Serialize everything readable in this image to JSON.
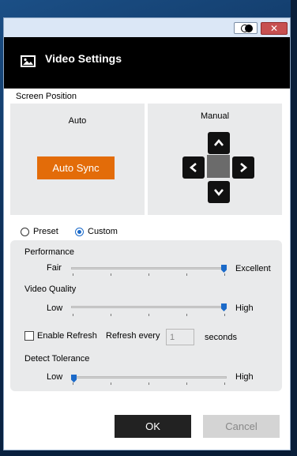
{
  "window": {
    "title": "Video Settings",
    "close_glyph": "✕",
    "icons": {
      "toggle": "contrast-toggle-icon",
      "close": "close-icon",
      "header": "image-icon"
    }
  },
  "screen_position": {
    "label": "Screen Position",
    "auto": {
      "label": "Auto",
      "button": "Auto Sync"
    },
    "manual": {
      "label": "Manual",
      "buttons": [
        "up-arrow-icon",
        "left-arrow-icon",
        "right-arrow-icon",
        "down-arrow-icon"
      ]
    }
  },
  "mode": {
    "options": [
      "Preset",
      "Custom"
    ],
    "selected": "Custom"
  },
  "performance": {
    "label": "Performance",
    "min_label": "Fair",
    "max_label": "Excellent",
    "value_fraction": 1.0
  },
  "video_quality": {
    "label": "Video Quality",
    "min_label": "Low",
    "max_label": "High",
    "value_fraction": 1.0
  },
  "refresh": {
    "enable_label": "Enable Refresh",
    "enabled": false,
    "every_label": "Refresh every",
    "value": "1",
    "unit": "seconds"
  },
  "detect_tolerance": {
    "label": "Detect Tolerance",
    "min_label": "Low",
    "max_label": "High",
    "value_fraction": 0.0
  },
  "footer": {
    "ok": "OK",
    "cancel": "Cancel"
  },
  "colors": {
    "accent": "#1b6ac9",
    "auto_sync": "#e36c09",
    "header_bg": "#000000",
    "panel_bg": "#e9eaeb"
  }
}
